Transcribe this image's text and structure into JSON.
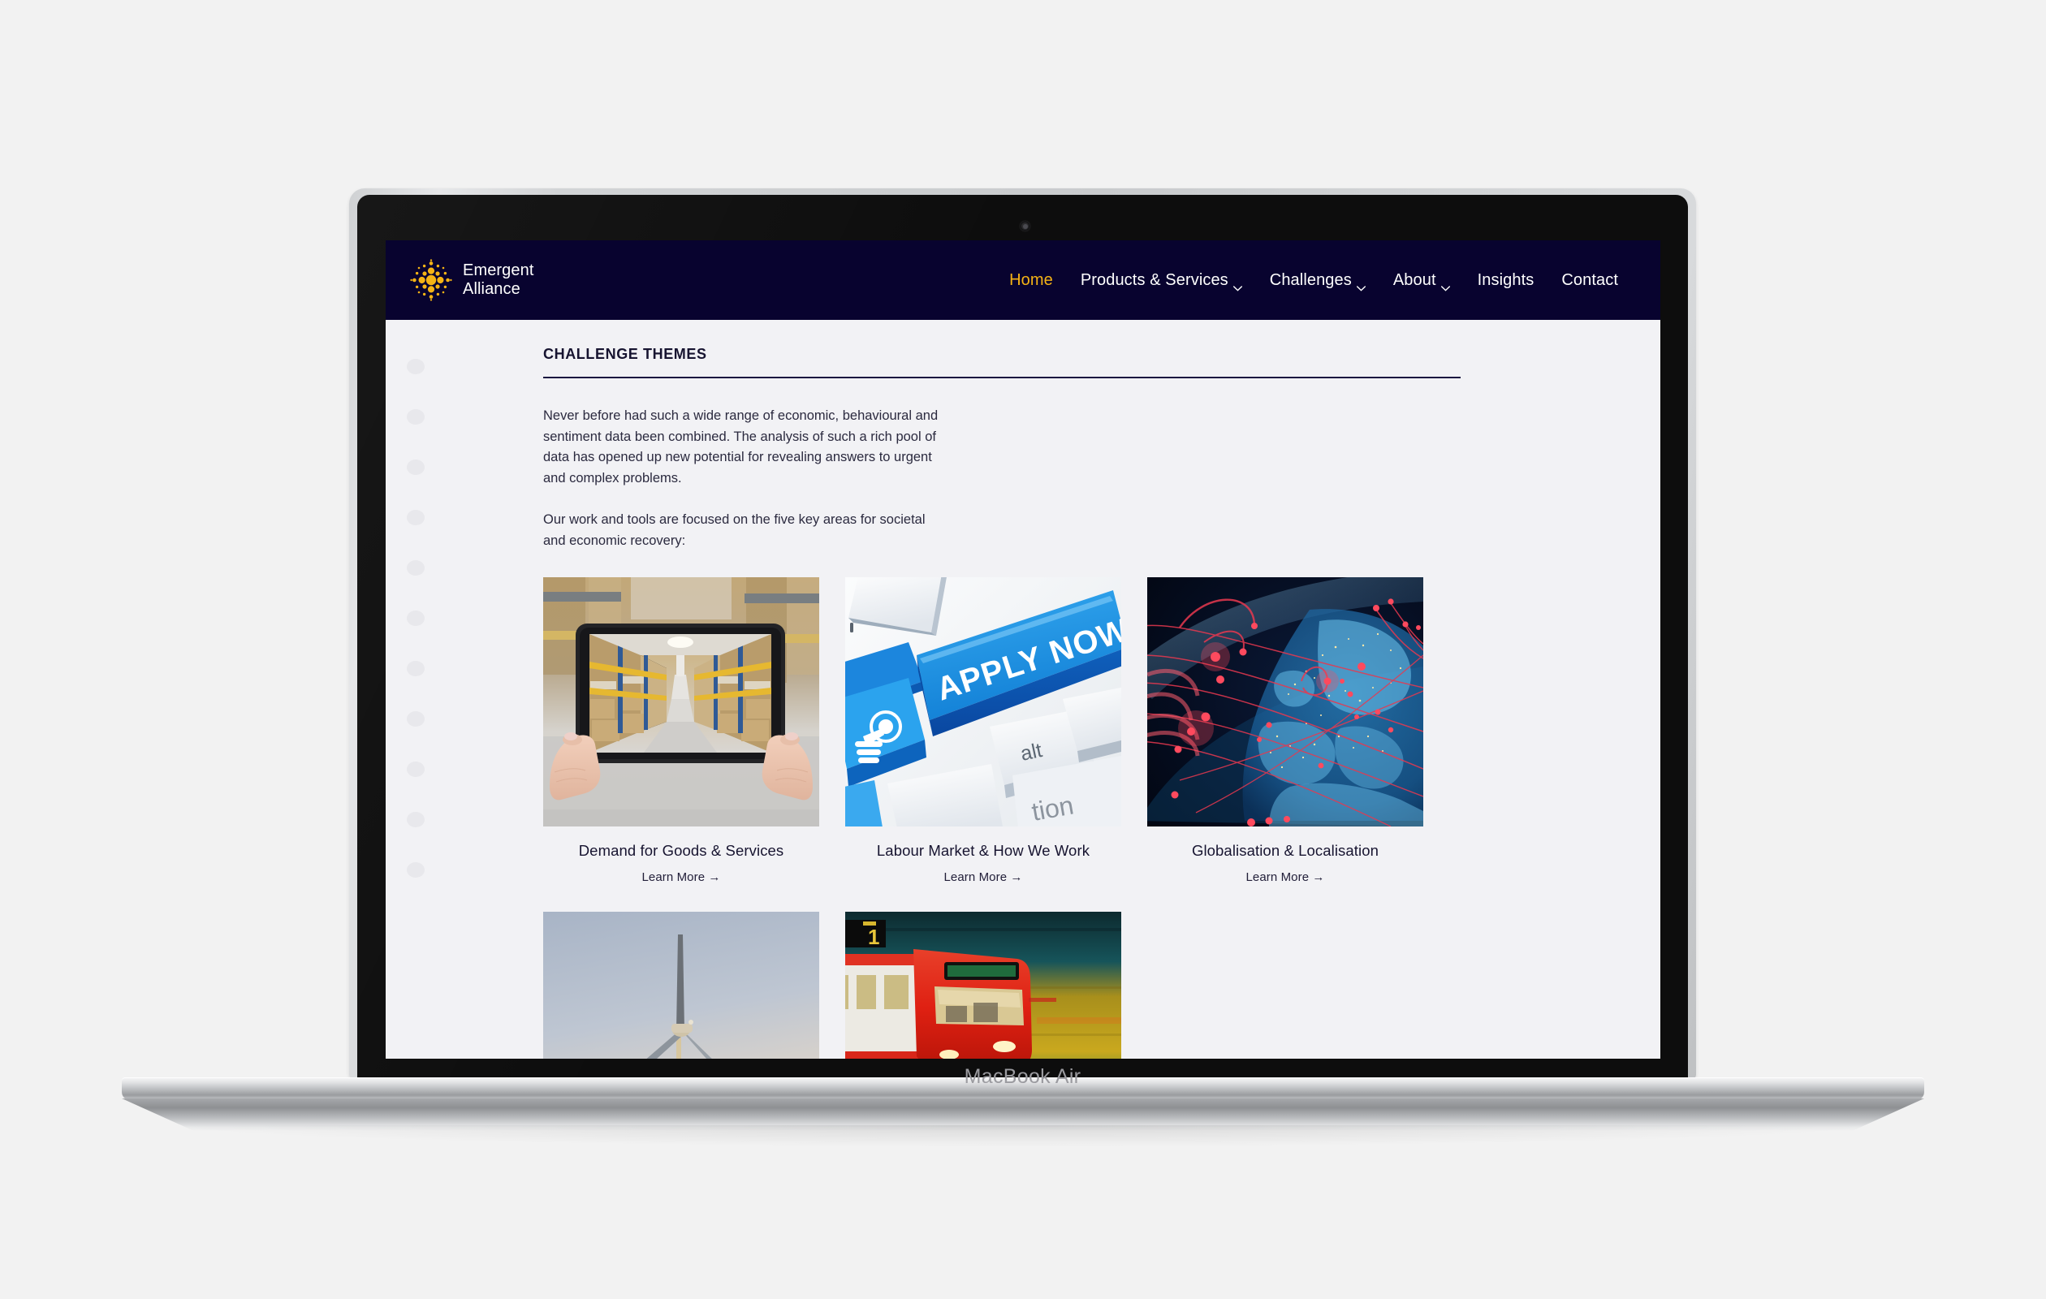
{
  "device": {
    "label": "MacBook Air"
  },
  "site": {
    "brand": {
      "name": "Emergent\nAlliance",
      "logo_icon": "radial-dots-logo-icon",
      "logo_color": "#f5b315"
    },
    "nav": {
      "items": [
        {
          "label": "Home",
          "has_dropdown": false,
          "active": true
        },
        {
          "label": "Products & Services",
          "has_dropdown": true,
          "active": false
        },
        {
          "label": "Challenges",
          "has_dropdown": true,
          "active": false
        },
        {
          "label": "About",
          "has_dropdown": true,
          "active": false
        },
        {
          "label": "Insights",
          "has_dropdown": false,
          "active": false
        },
        {
          "label": "Contact",
          "has_dropdown": false,
          "active": false
        }
      ]
    },
    "colors": {
      "navbar_bg": "#08032f",
      "accent": "#f5b315",
      "page_bg": "#f2f2f5",
      "text": "#171430"
    }
  },
  "page": {
    "section_title": "CHALLENGE THEMES",
    "intro_paragraphs": [
      "Never before had such a wide range of economic, behavioural and sentiment data been combined. The analysis of such a rich pool of data has opened up new potential for revealing answers to urgent and complex problems.",
      "Our work and tools are focused on the five key areas for societal and economic recovery:"
    ],
    "learn_more_label": "Learn More →",
    "themes": [
      {
        "title": "Demand for Goods & Services",
        "image_name": "tablet-warehouse-aisle-photo",
        "link_label": "Learn More →"
      },
      {
        "title": "Labour Market & How We Work",
        "image_name": "keyboard-apply-now-key-photo",
        "link_label": "Learn More →"
      },
      {
        "title": "Globalisation & Localisation",
        "image_name": "globe-network-connections-photo",
        "link_label": "Learn More →"
      },
      {
        "title": "",
        "image_name": "wind-turbine-sky-photo",
        "link_label": ""
      },
      {
        "title": "",
        "image_name": "red-tram-motion-blur-photo",
        "link_label": ""
      }
    ],
    "decorative_dots_count": 11
  }
}
